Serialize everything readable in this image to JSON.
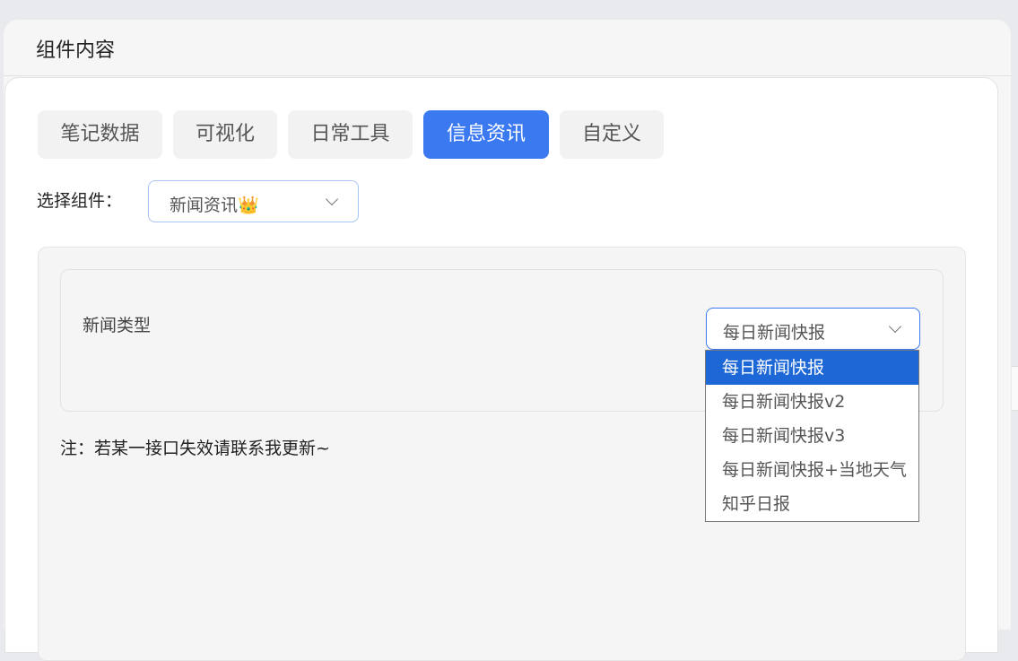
{
  "window": {
    "title": "组件内容"
  },
  "tabs": [
    {
      "label": "笔记数据",
      "active": false
    },
    {
      "label": "可视化",
      "active": false
    },
    {
      "label": "日常工具",
      "active": false
    },
    {
      "label": "信息资讯",
      "active": true
    },
    {
      "label": "自定义",
      "active": false
    }
  ],
  "component_select": {
    "label": "选择组件：",
    "value": "新闻资讯👑"
  },
  "news_type": {
    "label": "新闻类型",
    "value": "每日新闻快报",
    "options": [
      "每日新闻快报",
      "每日新闻快报v2",
      "每日新闻快报v3",
      "每日新闻快报+当地天气",
      "知乎日报"
    ],
    "selected_index": 0
  },
  "note": "注：若某一接口失效请联系我更新~",
  "colors": {
    "accent": "#3a79f0",
    "option_highlight": "#1d67d6"
  },
  "icons": {
    "dropdown": "chevron-down-icon"
  }
}
